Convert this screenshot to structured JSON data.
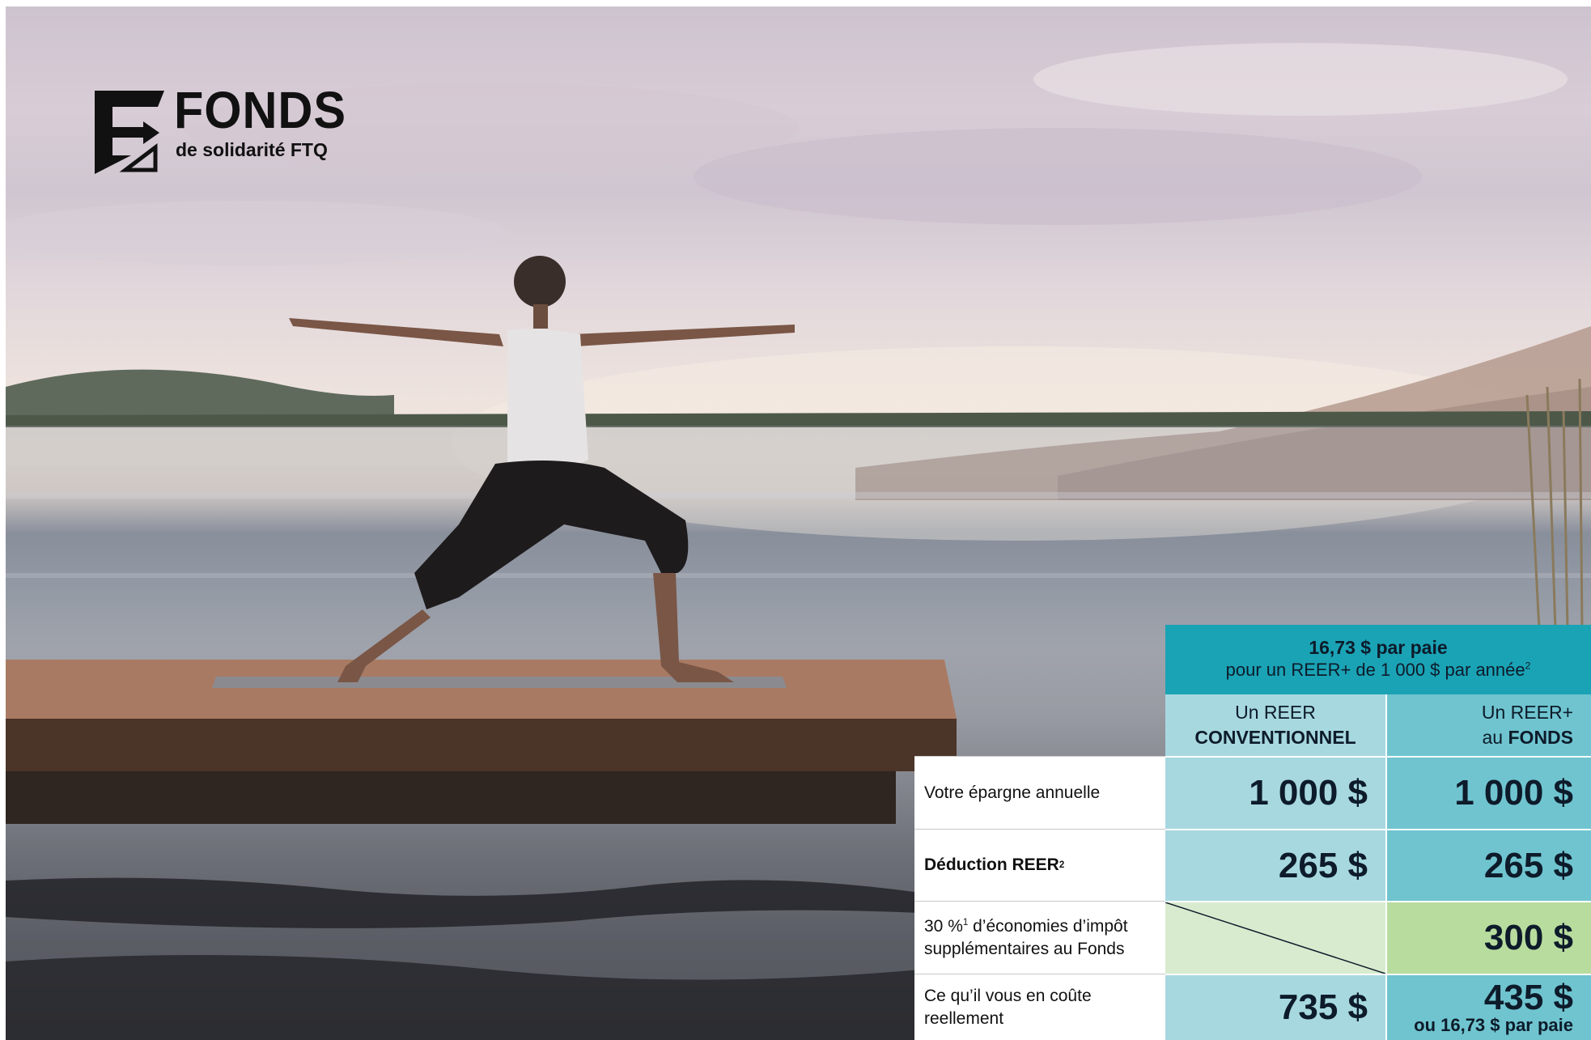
{
  "logo": {
    "title": "FONDS",
    "subtitle": "de solidarité FTQ"
  },
  "table": {
    "header": {
      "line1": "16,73 $ par paie",
      "line2": "pour un REER+ de 1 000 $ par année",
      "line2_sup": "2"
    },
    "col1": {
      "line1": "Un REER",
      "line2": "CONVENTIONNEL"
    },
    "col2": {
      "line1": "Un REER+",
      "line2_prefix": "au ",
      "line2_bold": "FONDS"
    },
    "rows": [
      {
        "label": "Votre épargne annuelle",
        "v1": "1 000 $",
        "v2": "1 000 $"
      },
      {
        "label": "Déduction REER",
        "label_sup": "2",
        "v1": "265 $",
        "v2": "265 $"
      },
      {
        "label_pre": "30 %",
        "label_sup": "1",
        "label_post": " d’économies d’impôt supplémentaires au Fonds",
        "v1": "",
        "v2": "300 $"
      },
      {
        "label": "Ce qu’il vous en coûte reellement",
        "v1": "735 $",
        "v2": "435 $",
        "v2_note": "ou 16,73 $ par paie"
      }
    ]
  },
  "colors": {
    "header_teal": "#1aa3b5",
    "col1_blue": "#a7d8e0",
    "col2_teal": "#6fc4cf",
    "green_light": "#d8ebcf",
    "green": "#b8dc9e"
  }
}
